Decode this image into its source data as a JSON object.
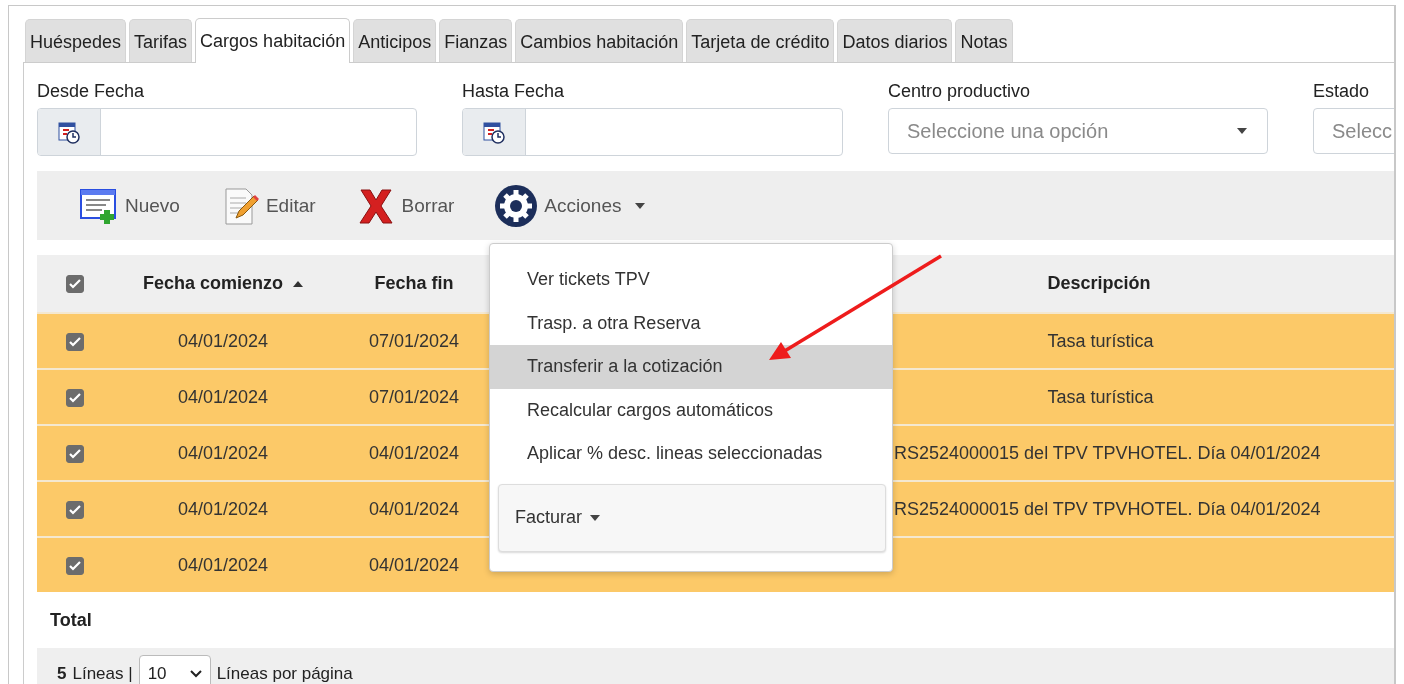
{
  "tabs": [
    {
      "label": "Huéspedes",
      "selected": false
    },
    {
      "label": "Tarifas",
      "selected": false
    },
    {
      "label": "Cargos habitación",
      "selected": true
    },
    {
      "label": "Anticipos",
      "selected": false
    },
    {
      "label": "Fianzas",
      "selected": false
    },
    {
      "label": "Cambios habitación",
      "selected": false
    },
    {
      "label": "Tarjeta de crédito",
      "selected": false
    },
    {
      "label": "Datos diarios",
      "selected": false
    },
    {
      "label": "Notas",
      "selected": false
    }
  ],
  "filters": [
    {
      "kind": "date",
      "label": "Desde Fecha"
    },
    {
      "kind": "date",
      "label": "Hasta Fecha"
    },
    {
      "kind": "select",
      "label": "Centro productivo",
      "placeholder": "Seleccione una opción",
      "arrow_visible": true
    },
    {
      "kind": "select",
      "label": "Estado",
      "placeholder": "Selecc"
    }
  ],
  "toolbar": [
    {
      "kind": "new",
      "label": "Nuevo"
    },
    {
      "kind": "edit",
      "label": "Editar"
    },
    {
      "kind": "delete",
      "label": "Borrar"
    },
    {
      "kind": "actions",
      "label": "Acciones"
    }
  ],
  "table": {
    "select_all": {
      "checked": true
    },
    "columns": [
      {
        "label": "Fecha comienzo",
        "sorted_ascending": true
      },
      {
        "label": "Fecha fin",
        "sorted_ascending": false
      },
      {
        "label": "Descripción",
        "sorted_ascending": false
      }
    ],
    "rows": [
      {
        "selected": true,
        "checked": true,
        "start": "04/01/2024",
        "end": "07/01/2024",
        "description": "Tasa turística"
      },
      {
        "selected": true,
        "checked": true,
        "start": "04/01/2024",
        "end": "07/01/2024",
        "description": "Tasa turística"
      },
      {
        "selected": true,
        "checked": true,
        "start": "04/01/2024",
        "end": "04/01/2024",
        "description": "RS2524000015 del TPV TPVHOTEL. Día 04/01/2024"
      },
      {
        "selected": true,
        "checked": true,
        "start": "04/01/2024",
        "end": "04/01/2024",
        "description": "RS2524000015 del TPV TPVHOTEL. Día 04/01/2024"
      },
      {
        "selected": true,
        "checked": true,
        "start": "04/01/2024",
        "end": "04/01/2024"
      }
    ]
  },
  "actions_menu": {
    "items": [
      {
        "label": "Ver tickets TPV",
        "highlighted": false
      },
      {
        "label": "Trasp. a otra Reserva",
        "highlighted": false
      },
      {
        "label": "Transferir a la cotización",
        "highlighted": true
      },
      {
        "label": "Recalcular cargos automáticos",
        "highlighted": false
      },
      {
        "label": "Aplicar % desc. lineas seleccionadas",
        "highlighted": false
      }
    ],
    "submenu_button": "Facturar"
  },
  "footer": {
    "total_label": "Total",
    "count": "5",
    "count_label": "Líneas |",
    "page_size": "10",
    "page_size_label": "Líneas por página"
  }
}
